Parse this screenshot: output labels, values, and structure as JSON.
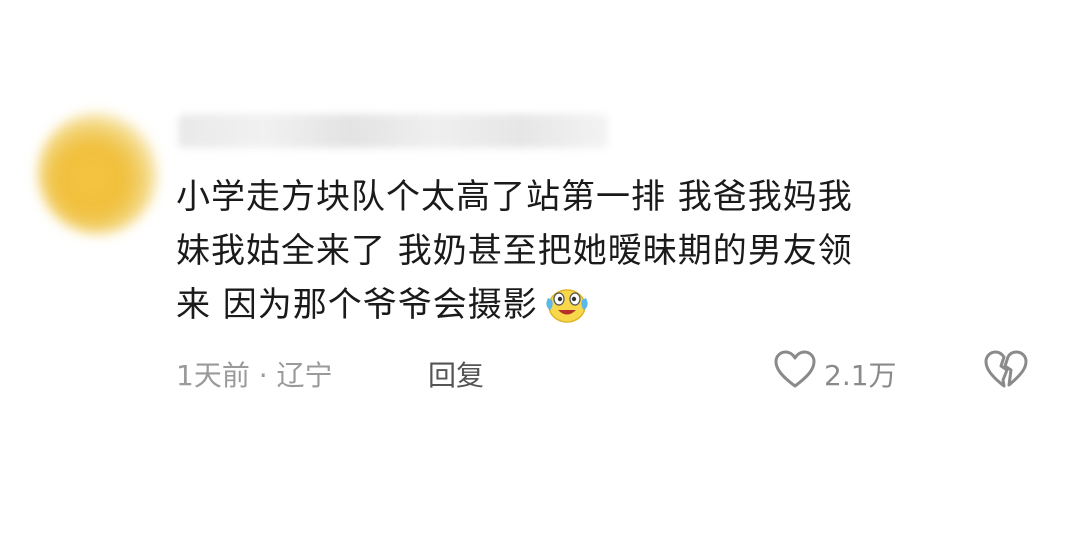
{
  "comment": {
    "text_lines": [
      "小学走方块队个太高了站第一排 我爸我妈我",
      "妹我姑全来了 我奶甚至把她暧昧期的男友领",
      "来 因为那个爷爷会摄影"
    ],
    "emoji": "laughing-crying-emoji",
    "time": "1天前",
    "separator": "·",
    "location": "辽宁",
    "reply_label": "回复",
    "like_count": "2.1万",
    "like_icon": "heart-outline-icon",
    "dislike_icon": "broken-heart-icon",
    "colors": {
      "text": "#1a1a1a",
      "meta": "#9a9a9a",
      "emoji_yellow": "#f7d84a",
      "emoji_tear": "#5ab8ec"
    }
  }
}
